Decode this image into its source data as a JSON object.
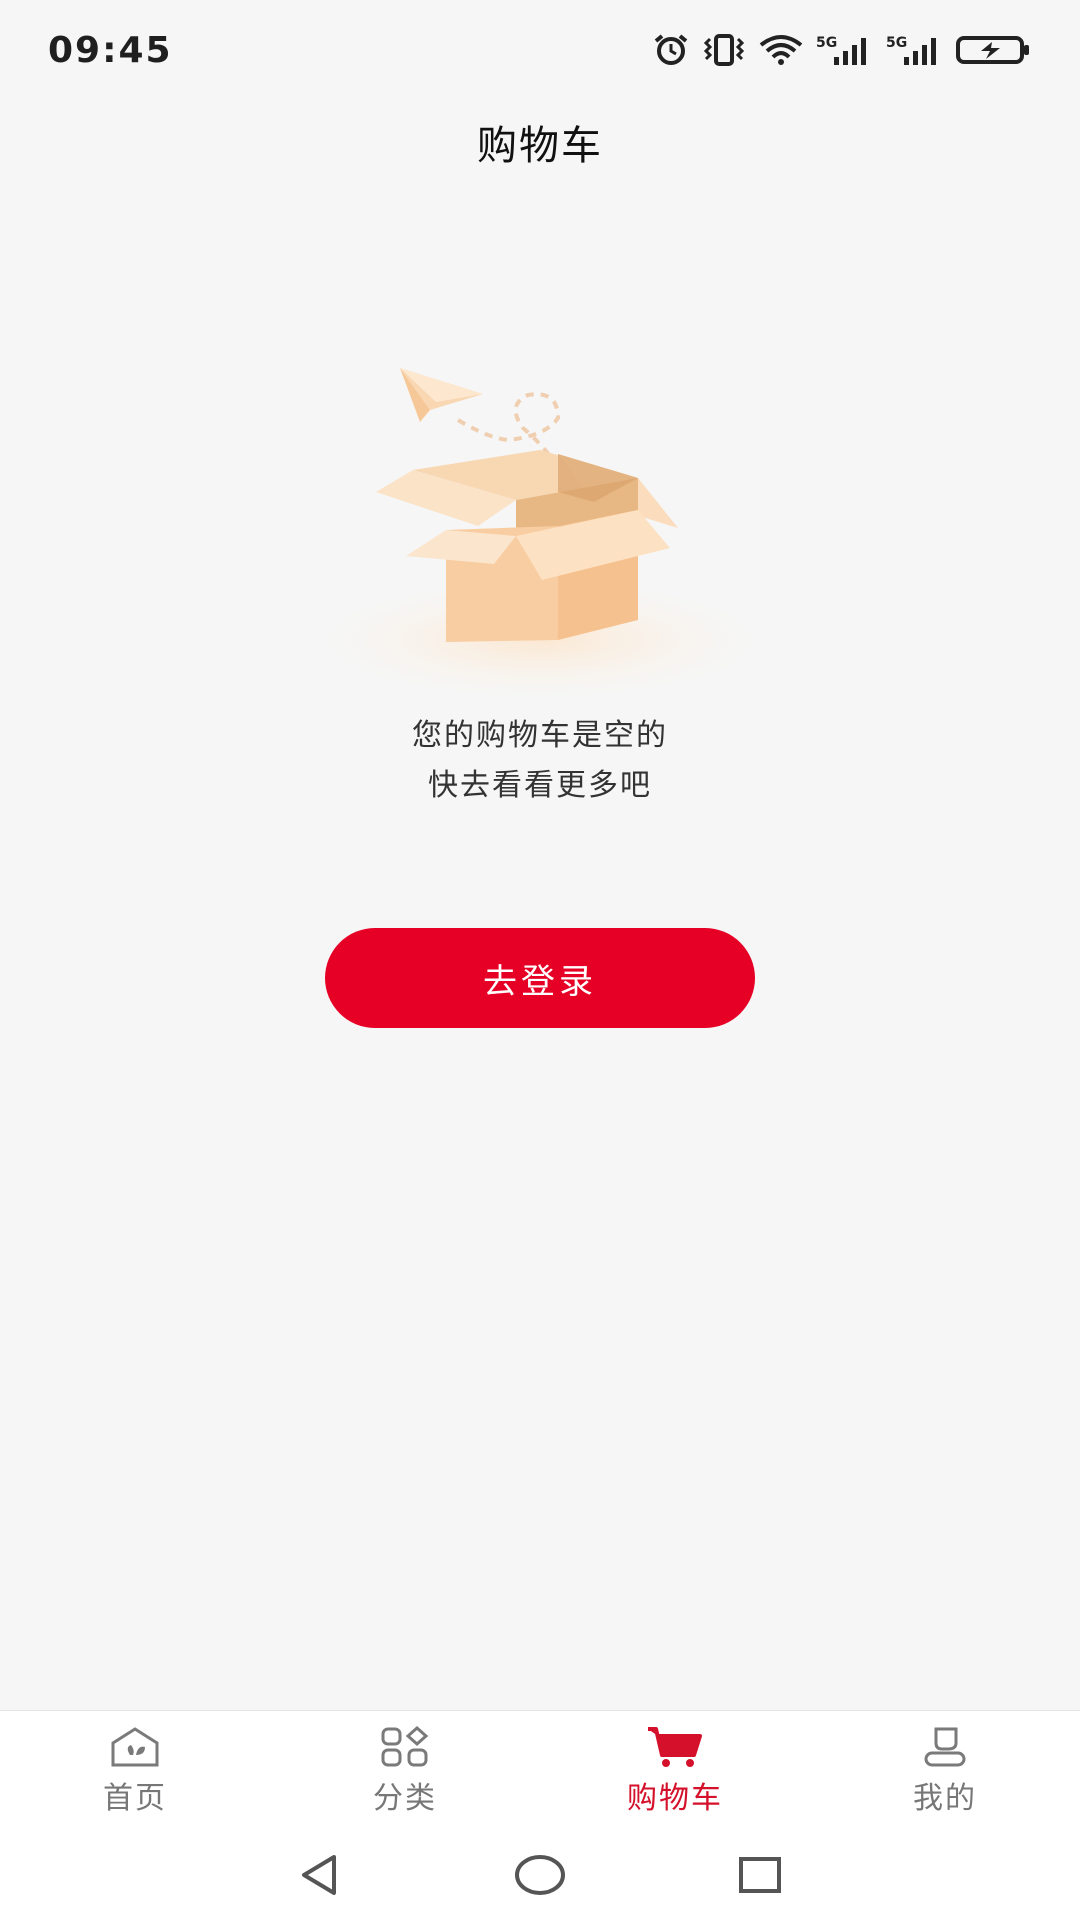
{
  "status_bar": {
    "time": "09:45",
    "icons": [
      "alarm-icon",
      "vibrate-icon",
      "wifi-icon",
      "signal-5g-icon",
      "signal-5g-icon",
      "battery-charging-icon"
    ],
    "network_labels": [
      "5G",
      "5G"
    ]
  },
  "header": {
    "title": "购物车"
  },
  "empty_state": {
    "illustration": "empty-box-paper-plane",
    "line1": "您的购物车是空的",
    "line2": "快去看看更多吧",
    "button_label": "去登录"
  },
  "tab_bar": {
    "items": [
      {
        "label": "首页",
        "icon": "home-icon",
        "active": false
      },
      {
        "label": "分类",
        "icon": "category-icon",
        "active": false
      },
      {
        "label": "购物车",
        "icon": "cart-icon",
        "active": true
      },
      {
        "label": "我的",
        "icon": "profile-icon",
        "active": false
      }
    ]
  },
  "colors": {
    "accent": "#e60026",
    "active_tab": "#d4102a",
    "background": "#f6f6f6",
    "tab_inactive": "#777777"
  },
  "system_nav": [
    "back-icon",
    "home-circle-icon",
    "recents-icon"
  ]
}
